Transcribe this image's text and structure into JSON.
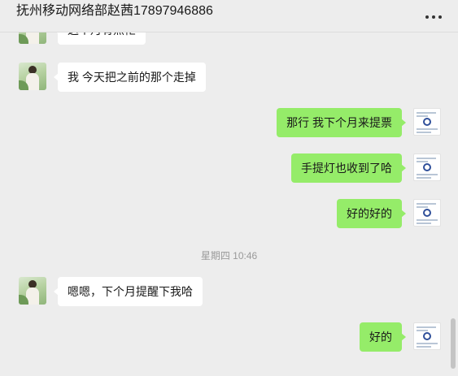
{
  "window": {
    "title": "抚州移动网络部赵茜17897946886"
  },
  "messages": [
    {
      "side": "in",
      "text": "这个月有点忙"
    },
    {
      "side": "in",
      "text": "我 今天把之前的那个走掉"
    },
    {
      "side": "out",
      "text": "那行 我下个月来提票"
    },
    {
      "side": "out",
      "text": "手提灯也收到了哈"
    },
    {
      "side": "out",
      "text": "好的好的"
    },
    {
      "side": "time",
      "text": "星期四 10:46"
    },
    {
      "side": "in",
      "text": "嗯嗯，下个月提醒下我哈"
    },
    {
      "side": "out",
      "text": "好的"
    }
  ],
  "colors": {
    "background": "#ededed",
    "incoming_bubble": "#ffffff",
    "outgoing_bubble": "#95ec69",
    "timestamp_text": "#9a9a9a"
  },
  "icons": {
    "more": "more-options-icon"
  }
}
